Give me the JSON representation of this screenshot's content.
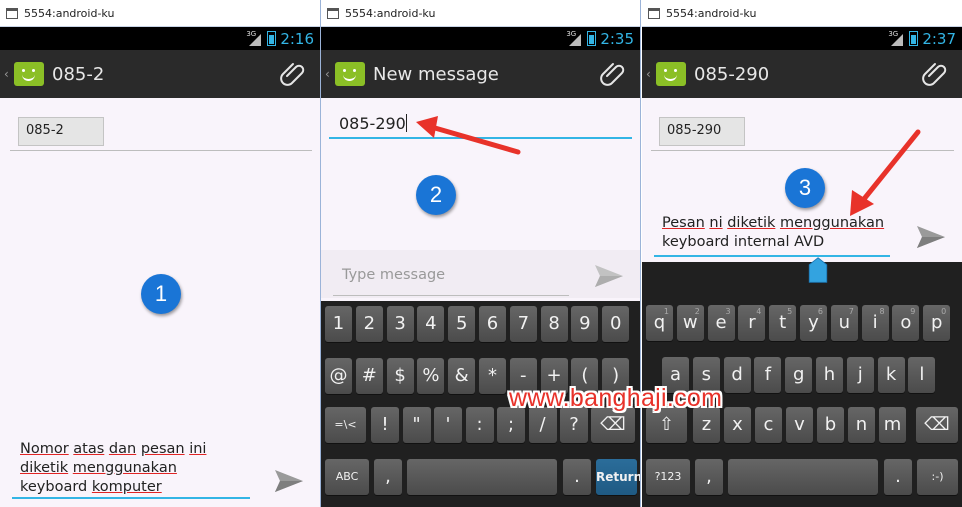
{
  "panels": [
    {
      "window_title": "5554:android-ku",
      "signal": "3G",
      "time": "2:16",
      "action_title": "085-2",
      "recipient_chip": "085-2",
      "badge": "1",
      "message_lines": [
        [
          {
            "t": "Nomor",
            "u": true
          },
          {
            "t": " "
          },
          {
            "t": "atas",
            "u": true
          },
          {
            "t": " "
          },
          {
            "t": "dan",
            "u": true
          },
          {
            "t": " "
          },
          {
            "t": "pesan",
            "u": true
          },
          {
            "t": " "
          },
          {
            "t": "ini",
            "u": true
          }
        ],
        [
          {
            "t": "diketik",
            "u": true
          },
          {
            "t": " "
          },
          {
            "t": "menggunakan",
            "u": true
          }
        ],
        [
          {
            "t": "keyboard "
          },
          {
            "t": "komputer",
            "u": true
          }
        ]
      ]
    },
    {
      "window_title": "5554:android-ku",
      "signal": "3G",
      "time": "2:35",
      "action_title": "New message",
      "to_input_value": "085-290",
      "badge": "2",
      "placeholder": "Type message"
    },
    {
      "window_title": "5554:android-ku",
      "signal": "3G",
      "time": "2:37",
      "action_title": "085-290",
      "recipient_chip": "085-290",
      "badge": "3",
      "message_lines": [
        [
          {
            "t": "Pesan",
            "u": true
          },
          {
            "t": " "
          },
          {
            "t": "ni",
            "u": true
          },
          {
            "t": " "
          },
          {
            "t": "diketik",
            "u": true
          },
          {
            "t": " "
          },
          {
            "t": "menggunakan",
            "u": true
          }
        ],
        [
          {
            "t": "keyboard internal AVD"
          }
        ]
      ]
    }
  ],
  "symbol_keyboard": {
    "row1": [
      "1",
      "2",
      "3",
      "4",
      "5",
      "6",
      "7",
      "8",
      "9",
      "0"
    ],
    "row2": [
      "@",
      "#",
      "$",
      "%",
      "&",
      "*",
      "-",
      "+",
      "(",
      ")"
    ],
    "row3": [
      "=\\<",
      "!",
      "\"",
      "'",
      ":",
      ";",
      "/",
      "?",
      "⌫"
    ],
    "row4": [
      "ABC",
      ",",
      "",
      ".",
      "Return"
    ]
  },
  "qwerty_keyboard": {
    "row1": [
      "q",
      "w",
      "e",
      "r",
      "t",
      "y",
      "u",
      "i",
      "o",
      "p"
    ],
    "row1_sub": [
      "1",
      "2",
      "3",
      "4",
      "5",
      "6",
      "7",
      "8",
      "9",
      "0"
    ],
    "row2": [
      "a",
      "s",
      "d",
      "f",
      "g",
      "h",
      "j",
      "k",
      "l"
    ],
    "row3": [
      "⇧",
      "z",
      "x",
      "c",
      "v",
      "b",
      "n",
      "m",
      "⌫"
    ],
    "row4": [
      "?123",
      ",",
      "",
      ".",
      ":-)"
    ]
  },
  "watermark": "www.banghaji.com",
  "colors": {
    "accent": "#33b5e5",
    "badge": "#1a75d6",
    "arrow": "#e8322a",
    "sms_icon": "#8bbf26"
  }
}
